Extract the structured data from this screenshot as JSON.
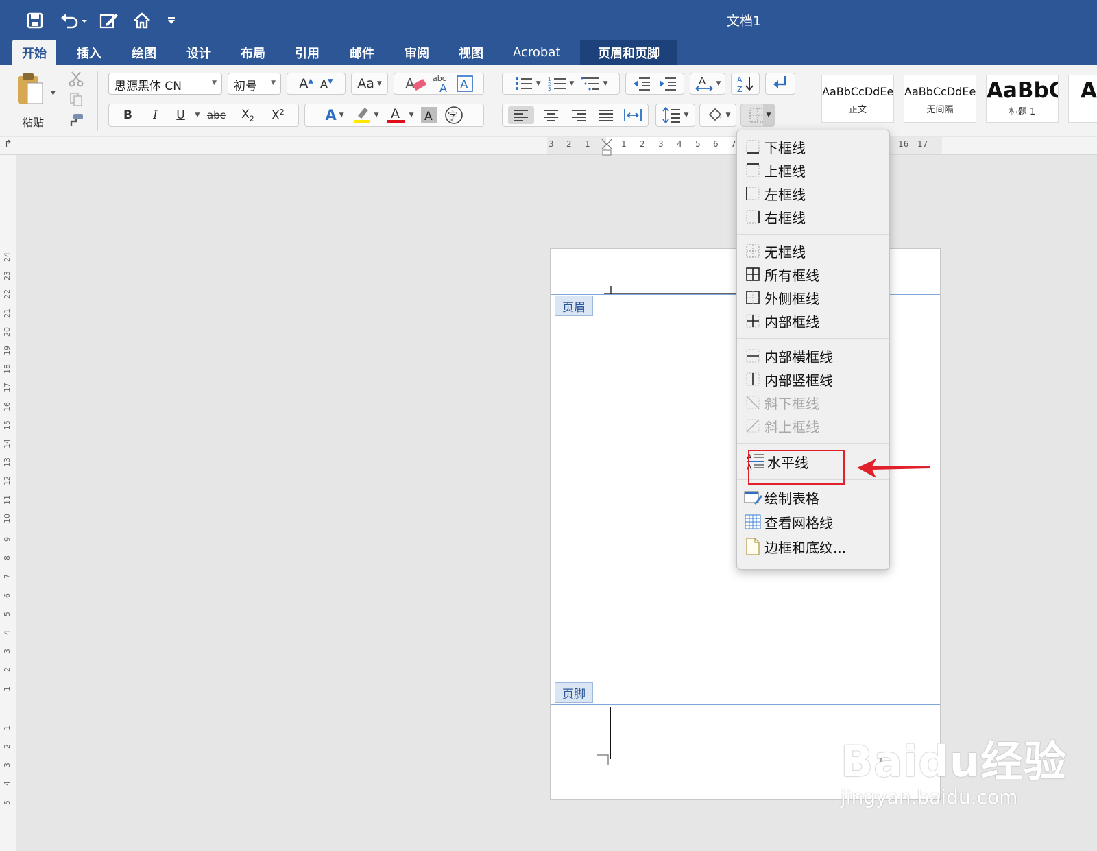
{
  "window": {
    "title": "文档1"
  },
  "tabs": [
    {
      "label": "开始"
    },
    {
      "label": "插入"
    },
    {
      "label": "绘图"
    },
    {
      "label": "设计"
    },
    {
      "label": "布局"
    },
    {
      "label": "引用"
    },
    {
      "label": "邮件"
    },
    {
      "label": "审阅"
    },
    {
      "label": "视图"
    },
    {
      "label": "Acrobat"
    },
    {
      "label": "页眉和页脚"
    }
  ],
  "ribbon": {
    "paste_label": "粘贴",
    "font_name": "思源黑体 CN",
    "font_size": "初号",
    "styles": [
      {
        "sample": "AaBbCcDdEe",
        "name": "正文"
      },
      {
        "sample": "AaBbCcDdEe",
        "name": "无间隔"
      },
      {
        "sample": "AaBbC",
        "name": "标题 1"
      }
    ],
    "colors": {
      "highlight": "#ffe800",
      "font_color": "#e0101a",
      "accent": "#2c5696"
    }
  },
  "ruler": {
    "marks": [
      "3",
      "2",
      "1",
      "1",
      "2",
      "3",
      "4",
      "5",
      "6",
      "7",
      "16",
      "17"
    ],
    "vmarks": [
      "24",
      "23",
      "22",
      "21",
      "20",
      "19",
      "18",
      "17",
      "16",
      "15",
      "14",
      "13",
      "12",
      "11",
      "10",
      "9",
      "8",
      "7",
      "6",
      "5",
      "4",
      "3",
      "2",
      "1",
      "1",
      "2",
      "3",
      "4",
      "5"
    ]
  },
  "page": {
    "header_tag": "页眉",
    "footer_tag": "页脚"
  },
  "border_menu": {
    "group1": [
      {
        "label": "下框线",
        "icon": "bottom-border-icon"
      },
      {
        "label": "上框线",
        "icon": "top-border-icon"
      },
      {
        "label": "左框线",
        "icon": "left-border-icon"
      },
      {
        "label": "右框线",
        "icon": "right-border-icon"
      }
    ],
    "group2": [
      {
        "label": "无框线",
        "icon": "no-border-icon"
      },
      {
        "label": "所有框线",
        "icon": "all-borders-icon"
      },
      {
        "label": "外侧框线",
        "icon": "outside-borders-icon"
      },
      {
        "label": "内部框线",
        "icon": "inside-borders-icon"
      }
    ],
    "group3": [
      {
        "label": "内部横框线",
        "icon": "inside-horizontal-border-icon"
      },
      {
        "label": "内部竖框线",
        "icon": "inside-vertical-border-icon"
      },
      {
        "label": "斜下框线",
        "icon": "diagonal-down-border-icon",
        "disabled": true
      },
      {
        "label": "斜上框线",
        "icon": "diagonal-up-border-icon",
        "disabled": true
      }
    ],
    "group4": [
      {
        "label": "水平线",
        "icon": "horizontal-line-icon",
        "highlighted": true
      }
    ],
    "group5": [
      {
        "label": "绘制表格",
        "icon": "draw-table-icon"
      },
      {
        "label": "查看网格线",
        "icon": "view-gridlines-icon"
      },
      {
        "label": "边框和底纹...",
        "icon": "borders-shading-icon"
      }
    ]
  },
  "watermark": {
    "logo": "Baidu经验",
    "url": "jingyan.baidu.com"
  }
}
